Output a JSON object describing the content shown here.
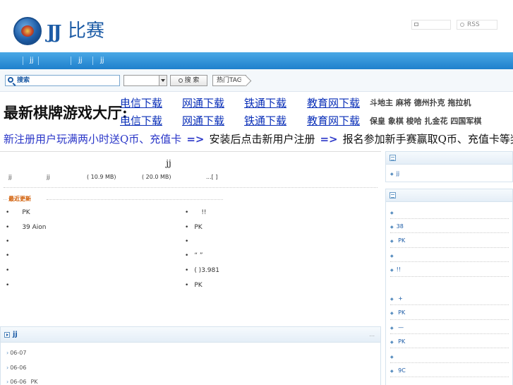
{
  "header": {
    "logo_text": "比赛",
    "logo_jj": "JJ",
    "rss_label": "RSS"
  },
  "nav": {
    "items": [
      "jj",
      "jj",
      "jj"
    ]
  },
  "search": {
    "input_label": "搜索",
    "button_label": "搜 索",
    "tag_label": "热门TAG"
  },
  "banner": {
    "title": "最新棋牌游戏大厅:",
    "row1_links": [
      "电信下载",
      "网通下载",
      "铁通下载",
      "教育网下载"
    ],
    "row2_links": [
      "电信下载",
      "网通下载",
      "铁通下载",
      "教育网下载"
    ],
    "row1_games": "斗地主  麻将  德州扑克  拖拉机",
    "row2_games": "保皇 象棋 梭哈 扎金花 四国军棋",
    "promo1": "新注册用户玩满两小时送Q币、充值卡",
    "promo_arrow": "=>",
    "promo2": "安装后点击新用户注册",
    "promo3": "报名参加新手赛赢取Q币、充值卡等奖励"
  },
  "article": {
    "title": "jj",
    "meta_a": "jj",
    "meta_b": "jj",
    "meta_size1": "(    10.9 MB)",
    "meta_size2": "(    20.0 MB)",
    "meta_more": "...[   ]"
  },
  "recent": {
    "heading": "最近更新",
    "left": [
      "PK",
      "39       Aion",
      "",
      "",
      "",
      ""
    ],
    "right": [
      "!!",
      "PK",
      "",
      "“   ”",
      "(     )3.981",
      "PK"
    ]
  },
  "list": {
    "title": "jj",
    "more": "...",
    "items": [
      {
        "date": "06-07",
        "name": ""
      },
      {
        "date": "06-06",
        "name": ""
      },
      {
        "date": "06-06",
        "name": "PK"
      }
    ]
  },
  "sidebar": {
    "box1_items": [
      "jj"
    ],
    "box2_items": [
      "",
      "38",
      "     PK",
      "",
      "!!",
      "    +",
      "   PK",
      "      —",
      "  PK",
      "",
      "   9C"
    ]
  }
}
